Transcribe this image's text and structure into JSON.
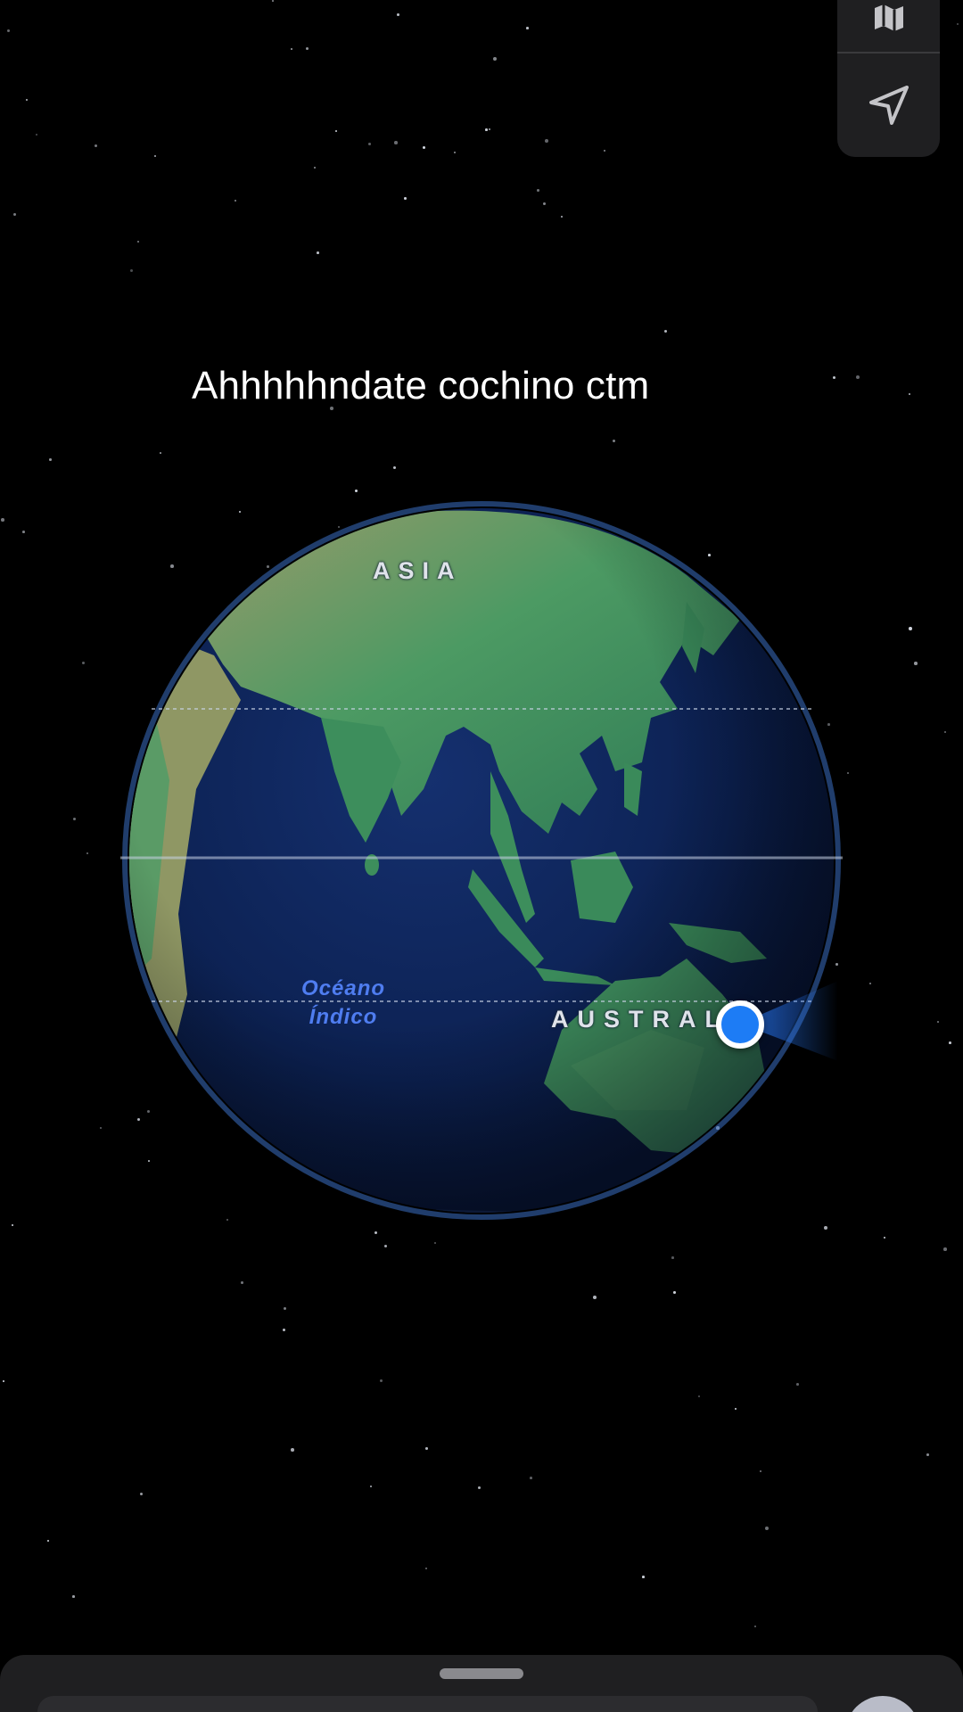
{
  "caption": "Ahhhhhndate cochino ctm",
  "controls": {
    "map_mode_icon": "map-icon",
    "locate_icon": "location-arrow-icon"
  },
  "map_labels": {
    "asia": "ASIA",
    "australia": "AUSTRALIA",
    "ocean_line1": "Océano",
    "ocean_line2": "Índico"
  },
  "colors": {
    "background": "#000000",
    "ocean": "#0d2358",
    "land_green": "#3f8f5f",
    "land_tan": "#9a9b6a",
    "location_dot": "#1d7cf5",
    "ocean_label": "#4f7df0"
  },
  "bottom_sheet": {
    "search_placeholder": ""
  }
}
